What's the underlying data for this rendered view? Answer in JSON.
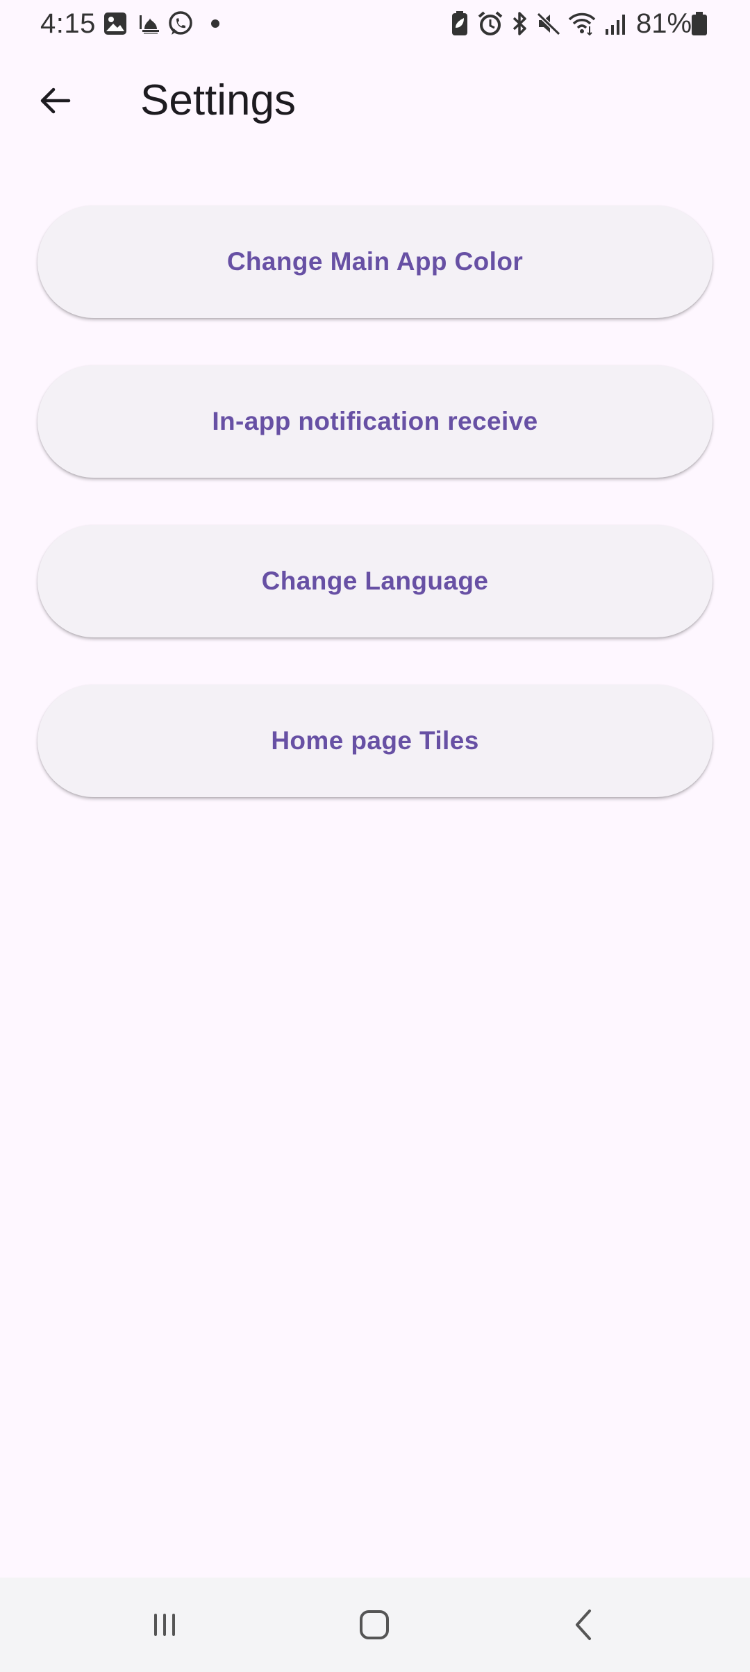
{
  "status_bar": {
    "time": "4:15",
    "battery_percent": "81%",
    "left_icons": [
      "gallery-icon",
      "mosque-icon",
      "whatsapp-icon",
      "dot-icon"
    ],
    "right_icons": [
      "battery-saver-icon",
      "alarm-icon",
      "bluetooth-icon",
      "mute-icon",
      "wifi-icon",
      "signal-icon",
      "battery-icon"
    ]
  },
  "app_bar": {
    "back_icon": "arrow-left-icon",
    "title": "Settings"
  },
  "settings": {
    "buttons": [
      {
        "label": "Change Main App Color"
      },
      {
        "label": "In-app notification receive"
      },
      {
        "label": "Change Language"
      },
      {
        "label": "Home page Tiles"
      }
    ]
  },
  "nav_bar": {
    "recents_icon": "recents-icon",
    "home_icon": "home-icon",
    "back_icon": "back-chevron-icon"
  },
  "colors": {
    "background": "#FEF7FF",
    "button_background": "#F4F1F6",
    "button_text": "#6750A4",
    "title_text": "#1D1B20",
    "nav_bar_background": "#F4F4F6"
  }
}
